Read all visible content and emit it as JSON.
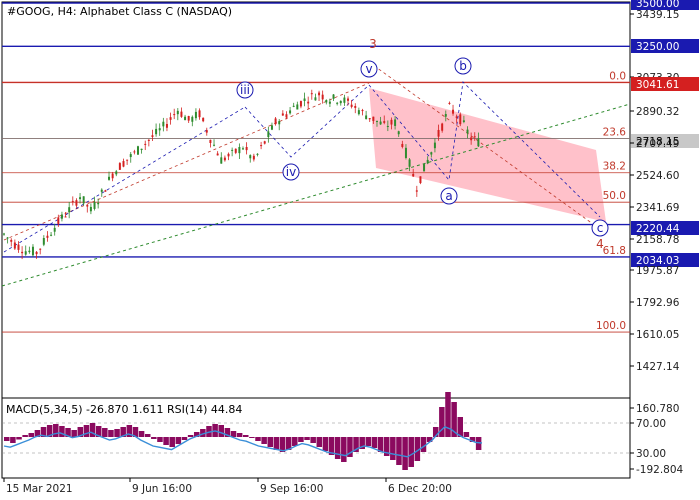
{
  "title": "#GOOG, H4:  Alphabet Class C (NASDAQ)",
  "indicator_label": "MACD(5,34,5) -26.870 1.611 RSI(14) 44.84",
  "colors": {
    "bull": "#2e8b2e",
    "bear": "#d42020",
    "fib_line": "#c0392b",
    "level_line": "#1a1ab0",
    "tag_bg": "#1a1ab0",
    "red_tag_bg": "#d42020",
    "channel_fill": "#ffb6c1",
    "trend_green": "#2e8b2e",
    "macd_bar": "#8b0a5f",
    "signal": "#3a8fd8",
    "wave_label": "#1a1ab0",
    "wave_red": "#c0392b",
    "axis": "#000000"
  },
  "chart_data": {
    "type": "candlestick",
    "y_range": [
      1900.0,
      3500.0
    ],
    "y_ticks": [
      "3500.00",
      "3439.15",
      "3250.00",
      "3073.30",
      "3041.61",
      "2890.32",
      "2718.15",
      "2707.49",
      "2524.60",
      "2341.69",
      "2220.44",
      "2158.78",
      "2034.03",
      "1975.87",
      "1792.96",
      "1610.05",
      "1427.14"
    ],
    "x_ticks": [
      "15 Mar 2021",
      "9 Jun 16:00",
      "9 Sep 16:00",
      "6 Dec 20:00"
    ],
    "levels": [
      {
        "price": 3500.0,
        "label": "3500.00",
        "style": "blue"
      },
      {
        "price": 3250.0,
        "label": "3250.00",
        "style": "blue"
      },
      {
        "price": 3041.61,
        "label": "3041.61",
        "style": "red"
      },
      {
        "price": 2220.44,
        "label": "2220.44",
        "style": "blue"
      },
      {
        "price": 2034.03,
        "label": "2034.03",
        "style": "blue"
      }
    ],
    "current_price": {
      "price": 2718.15,
      "label": "2718.15"
    },
    "fib_levels": [
      {
        "label": "0.0",
        "price": 3041.61
      },
      {
        "label": "23.6",
        "price": 2718.15
      },
      {
        "label": "38.2",
        "price": 2520.0
      },
      {
        "label": "50.0",
        "price": 2350.0
      },
      {
        "label": "61.8",
        "price": 2034.03
      },
      {
        "label": "100.0",
        "price": 1600.0
      }
    ],
    "waves": [
      {
        "label": "iii",
        "date": "Jun 2021",
        "price": 2930
      },
      {
        "label": "iv",
        "date": "Aug 2021",
        "price": 2570
      },
      {
        "label": "v",
        "date": "Oct 2021",
        "price": 3000
      },
      {
        "label": "3",
        "date": "Oct 2021",
        "price": 3100
      },
      {
        "label": "a",
        "date": "Nov 2021",
        "price": 2450
      },
      {
        "label": "b",
        "date": "Dec 2021",
        "price": 2990
      },
      {
        "label": "c",
        "date": "Jan 2022",
        "price": 2200
      },
      {
        "label": "4",
        "date": "Jan 2022",
        "price": 2150
      }
    ],
    "price_path": [
      [
        2200,
        2130
      ],
      [
        2140,
        2075
      ],
      [
        2100,
        2040
      ],
      [
        2070,
        2050
      ],
      [
        2180,
        2120
      ],
      [
        2290,
        2180
      ],
      [
        2370,
        2240
      ],
      [
        2450,
        2320
      ],
      [
        2300,
        2300
      ],
      [
        2420,
        2380
      ],
      [
        2560,
        2470
      ],
      [
        2600,
        2560
      ],
      [
        2660,
        2600
      ],
      [
        2720,
        2660
      ],
      [
        2790,
        2700
      ],
      [
        2850,
        2760
      ],
      [
        2930,
        2840
      ],
      [
        2860,
        2780
      ],
      [
        2900,
        2820
      ],
      [
        2760,
        2680
      ],
      [
        2610,
        2580
      ],
      [
        2650,
        2600
      ],
      [
        2700,
        2640
      ],
      [
        2620,
        2560
      ],
      [
        2740,
        2650
      ],
      [
        2860,
        2760
      ],
      [
        2900,
        2820
      ],
      [
        2950,
        2880
      ],
      [
        2980,
        2920
      ],
      [
        3000,
        2950
      ],
      [
        2970,
        2920
      ],
      [
        2980,
        2910
      ],
      [
        2950,
        2880
      ],
      [
        2900,
        2830
      ],
      [
        2860,
        2800
      ],
      [
        2820,
        2760
      ],
      [
        2840,
        2780
      ],
      [
        2690,
        2580
      ],
      [
        2480,
        2400
      ],
      [
        2660,
        2520
      ],
      [
        2780,
        2700
      ],
      [
        2990,
        2800
      ],
      [
        2900,
        2760
      ],
      [
        2760,
        2680
      ],
      [
        2720,
        2660
      ]
    ],
    "indicator": {
      "name": "MACD / RSI",
      "y_ticks": [
        "160.780",
        "70.00",
        "30.00",
        "-192.804"
      ],
      "macd_values": [
        -8,
        -12,
        -5,
        4,
        8,
        14,
        20,
        24,
        26,
        22,
        18,
        14,
        20,
        24,
        28,
        22,
        18,
        14,
        16,
        20,
        24,
        20,
        12,
        6,
        -4,
        -10,
        -16,
        -20,
        -14,
        -6,
        4,
        10,
        16,
        22,
        26,
        24,
        18,
        12,
        8,
        4,
        -2,
        -8,
        -14,
        -20,
        -26,
        -30,
        -26,
        -18,
        -10,
        -6,
        -12,
        -20,
        -28,
        -36,
        -44,
        -50,
        -40,
        -30,
        -24,
        -18,
        -22,
        -30,
        -38,
        -46,
        -56,
        -66,
        -60,
        -48,
        -30,
        -10,
        20,
        60,
        90,
        70,
        40,
        10,
        -10,
        -26
      ],
      "rsi_values": [
        40,
        38,
        42,
        46,
        50,
        55,
        58,
        56,
        60,
        62,
        58,
        54,
        56,
        60,
        63,
        58,
        54,
        50,
        52,
        56,
        60,
        57,
        50,
        45,
        40,
        38,
        36,
        34,
        40,
        46,
        52,
        56,
        60,
        63,
        65,
        62,
        58,
        54,
        50,
        48,
        44,
        40,
        38,
        36,
        34,
        32,
        35,
        40,
        44,
        42,
        38,
        34,
        30,
        28,
        26,
        24,
        30,
        36,
        40,
        38,
        34,
        30,
        28,
        26,
        24,
        22,
        28,
        35,
        42,
        50,
        62,
        72,
        68,
        60,
        54,
        50,
        46,
        45
      ]
    }
  }
}
